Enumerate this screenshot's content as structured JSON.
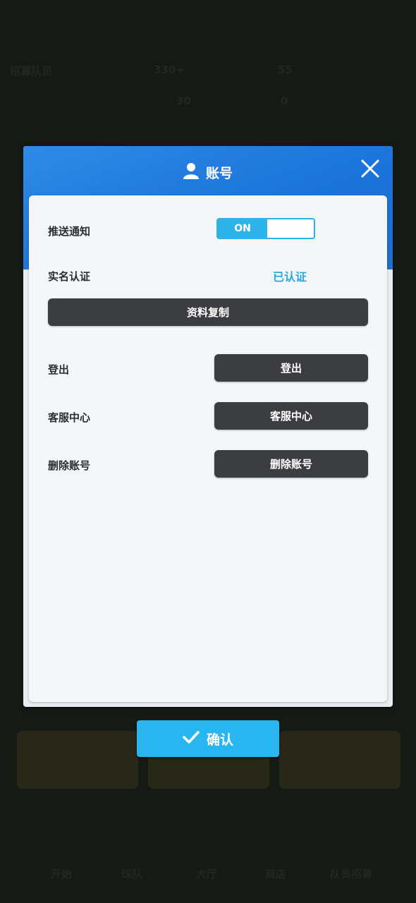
{
  "background": {
    "topbar": {
      "label": "招募队员",
      "stat1": "330+",
      "stat2": "55",
      "stat3": "30",
      "stat4": "0"
    },
    "nav": [
      "开始",
      "球队",
      "大厅",
      "商店",
      "队员招募"
    ]
  },
  "modal": {
    "title": "账号",
    "push_label": "推送通知",
    "push_toggle": "ON",
    "realname_label": "实名认证",
    "realname_status": "已认证",
    "copy_button": "资料复制",
    "logout_label": "登出",
    "logout_button": "登出",
    "service_label": "客服中心",
    "service_button": "客服中心",
    "delete_label": "删除账号",
    "delete_button": "删除账号"
  },
  "confirm_button": "确认",
  "colors": {
    "header_blue": "#1a73d9",
    "toggle_accent": "#2cb3e8",
    "verified_text": "#29a9df",
    "dark_button": "#3b3d40",
    "confirm_button": "#27b6ef"
  }
}
